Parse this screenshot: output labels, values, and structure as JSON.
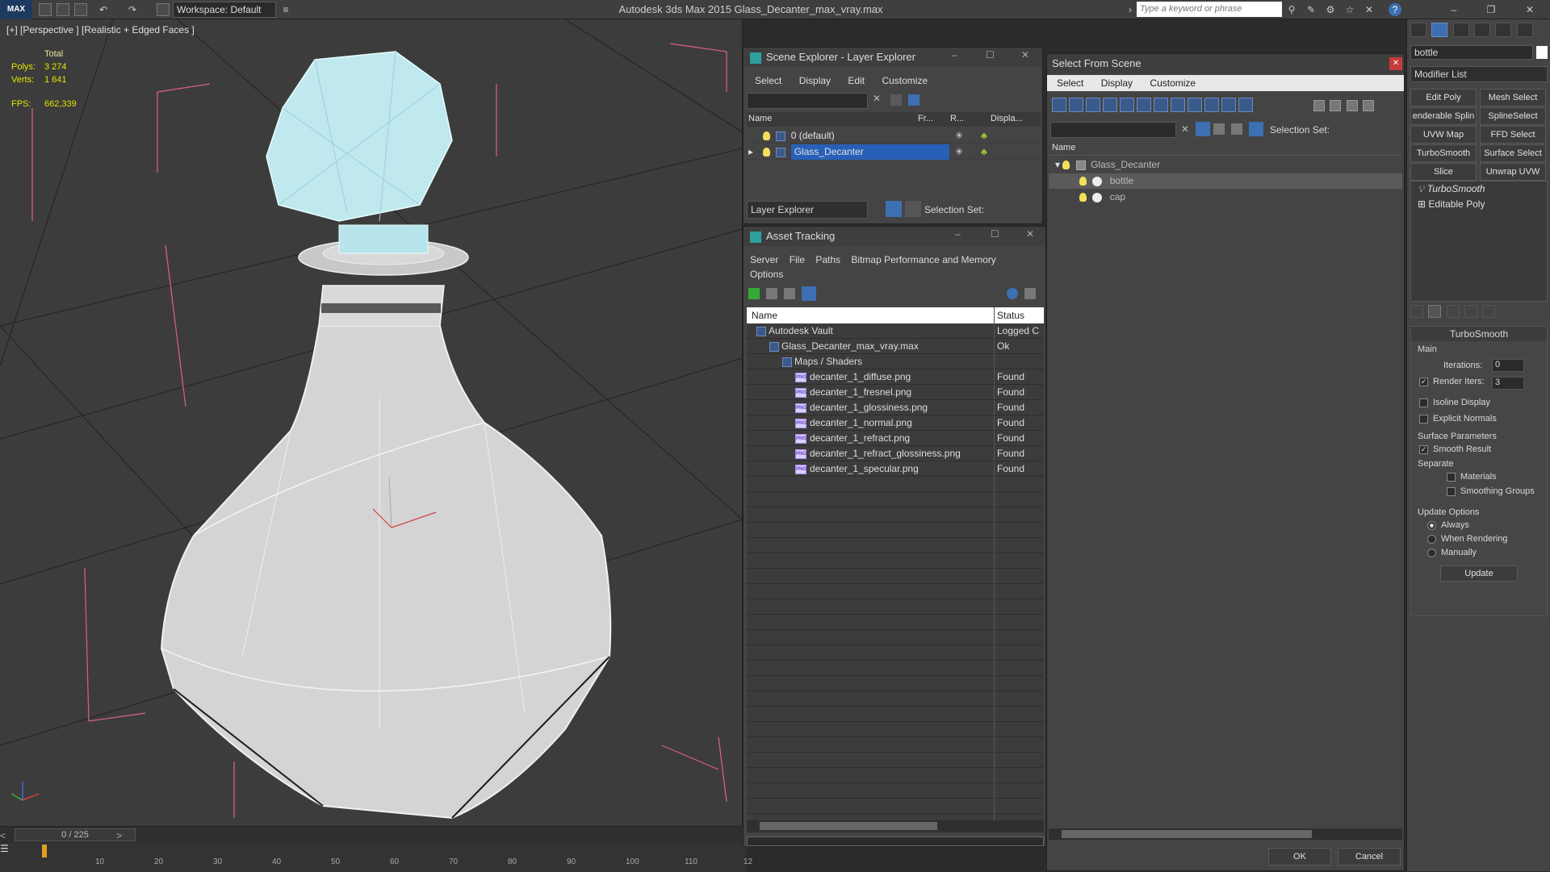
{
  "app": {
    "title": "Autodesk 3ds Max  2015    Glass_Decanter_max_vray.max",
    "workspace": "Workspace: Default",
    "search_placeholder": "Type a keyword or phrase",
    "logo": "MAX"
  },
  "viewport": {
    "label": "[+] [Perspective ] [Realistic + Edged Faces ]",
    "stats": {
      "total_label": "Total",
      "polys_label": "Polys:",
      "polys": "3 274",
      "verts_label": "Verts:",
      "verts": "1 641",
      "fps_label": "FPS:",
      "fps": "662,339"
    },
    "axis": {
      "x": "x",
      "y": "y",
      "z": "z"
    }
  },
  "timeline": {
    "slider": "0 / 225",
    "ticks": [
      "10",
      "20",
      "30",
      "40",
      "50",
      "60",
      "70",
      "80",
      "90",
      "100",
      "110",
      "12"
    ]
  },
  "scene_explorer": {
    "title": "Scene Explorer - Layer Explorer",
    "menu": [
      "Select",
      "Display",
      "Edit",
      "Customize"
    ],
    "columns": [
      "Name",
      "Fr...",
      "R...",
      "Displa..."
    ],
    "rows": [
      {
        "name": "0 (default)"
      },
      {
        "name": "Glass_Decanter"
      }
    ],
    "footer_dropdown": "Layer Explorer",
    "selection_set": "Selection Set:"
  },
  "asset_tracking": {
    "title": "Asset Tracking",
    "menu": [
      "Server",
      "File",
      "Paths",
      "Bitmap Performance and Memory"
    ],
    "menu2": "Options",
    "columns": [
      "Name",
      "Status"
    ],
    "rows": [
      {
        "name": "Autodesk Vault",
        "status": "Logged C",
        "indent": 0
      },
      {
        "name": "Glass_Decanter_max_vray.max",
        "status": "Ok",
        "indent": 1
      },
      {
        "name": "Maps / Shaders",
        "status": "",
        "indent": 2
      },
      {
        "name": "decanter_1_diffuse.png",
        "status": "Found",
        "indent": 3
      },
      {
        "name": "decanter_1_fresnel.png",
        "status": "Found",
        "indent": 3
      },
      {
        "name": "decanter_1_glossiness.png",
        "status": "Found",
        "indent": 3
      },
      {
        "name": "decanter_1_normal.png",
        "status": "Found",
        "indent": 3
      },
      {
        "name": "decanter_1_refract.png",
        "status": "Found",
        "indent": 3
      },
      {
        "name": "decanter_1_refract_glossiness.png",
        "status": "Found",
        "indent": 3
      },
      {
        "name": "decanter_1_specular.png",
        "status": "Found",
        "indent": 3
      }
    ]
  },
  "select_from_scene": {
    "title": "Select From Scene",
    "menu": [
      "Select",
      "Display",
      "Customize"
    ],
    "selection_set": "Selection Set:",
    "name_header": "Name",
    "tree": [
      {
        "name": "Glass_Decanter"
      },
      {
        "name": "bottle"
      },
      {
        "name": "cap"
      }
    ],
    "ok": "OK",
    "cancel": "Cancel"
  },
  "command_panel": {
    "object_name": "bottle",
    "modifier_list": "Modifier List",
    "buttons": [
      "Edit Poly",
      "Mesh Select",
      "enderable Splin",
      "SplineSelect",
      "UVW Map",
      "FFD Select",
      "TurboSmooth",
      "Surface Select",
      "Slice",
      "Unwrap UVW"
    ],
    "stack": [
      "TurboSmooth",
      "Editable Poly"
    ],
    "rollout": {
      "title": "TurboSmooth",
      "main": "Main",
      "iterations_label": "Iterations:",
      "iterations": "0",
      "render_iters_label": "Render Iters:",
      "render_iters": "3",
      "isoline": "Isoline Display",
      "explicit_normals": "Explicit Normals",
      "surface_params": "Surface Parameters",
      "smooth_result": "Smooth Result",
      "separate": "Separate",
      "materials": "Materials",
      "smoothing_groups": "Smoothing Groups",
      "update_options": "Update Options",
      "always": "Always",
      "when_rendering": "When Rendering",
      "manually": "Manually",
      "update_btn": "Update"
    }
  }
}
